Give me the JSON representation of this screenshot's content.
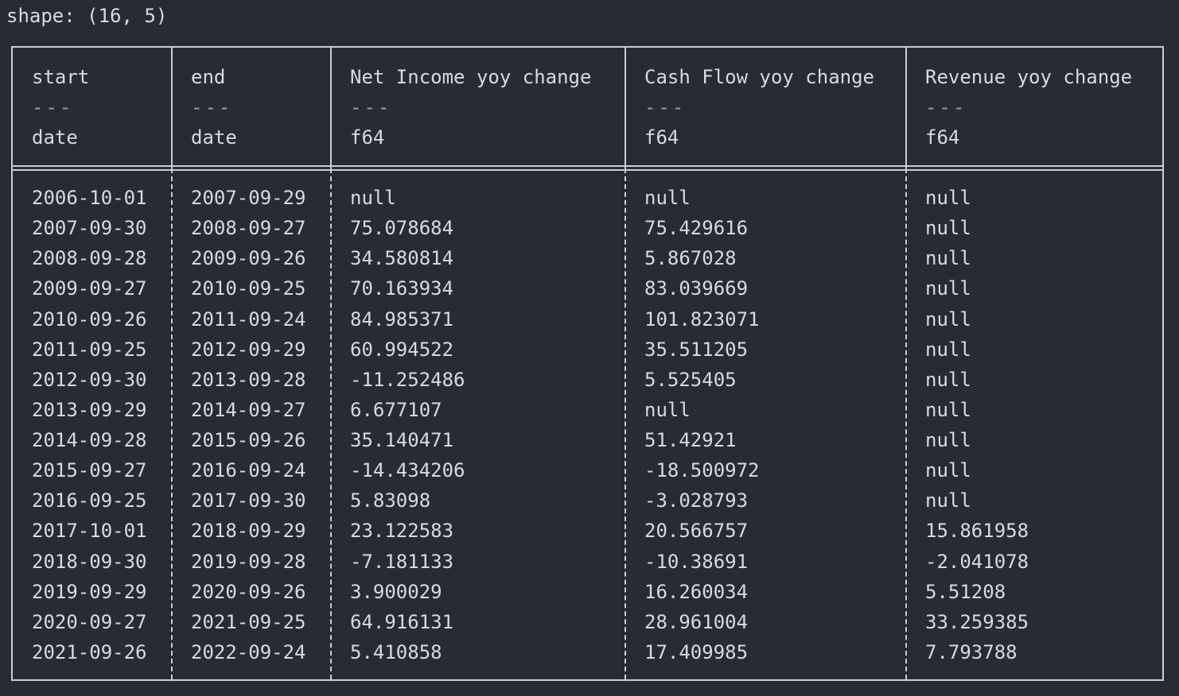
{
  "shape_text": "shape: (16, 5)",
  "table": {
    "columns": [
      {
        "name": "start",
        "separator": "---",
        "dtype": "date"
      },
      {
        "name": "end",
        "separator": "---",
        "dtype": "date"
      },
      {
        "name": "Net Income yoy change",
        "separator": "---",
        "dtype": "f64"
      },
      {
        "name": "Cash Flow yoy change",
        "separator": "---",
        "dtype": "f64"
      },
      {
        "name": "Revenue yoy change",
        "separator": "---",
        "dtype": "f64"
      }
    ],
    "rows": [
      [
        "2006-10-01",
        "2007-09-29",
        "null",
        "null",
        "null"
      ],
      [
        "2007-09-30",
        "2008-09-27",
        "75.078684",
        "75.429616",
        "null"
      ],
      [
        "2008-09-28",
        "2009-09-26",
        "34.580814",
        "5.867028",
        "null"
      ],
      [
        "2009-09-27",
        "2010-09-25",
        "70.163934",
        "83.039669",
        "null"
      ],
      [
        "2010-09-26",
        "2011-09-24",
        "84.985371",
        "101.823071",
        "null"
      ],
      [
        "2011-09-25",
        "2012-09-29",
        "60.994522",
        "35.511205",
        "null"
      ],
      [
        "2012-09-30",
        "2013-09-28",
        "-11.252486",
        "5.525405",
        "null"
      ],
      [
        "2013-09-29",
        "2014-09-27",
        "6.677107",
        "null",
        "null"
      ],
      [
        "2014-09-28",
        "2015-09-26",
        "35.140471",
        "51.42921",
        "null"
      ],
      [
        "2015-09-27",
        "2016-09-24",
        "-14.434206",
        "-18.500972",
        "null"
      ],
      [
        "2016-09-25",
        "2017-09-30",
        "5.83098",
        "-3.028793",
        "null"
      ],
      [
        "2017-10-01",
        "2018-09-29",
        "23.122583",
        "20.566757",
        "15.861958"
      ],
      [
        "2018-09-30",
        "2019-09-28",
        "-7.181133",
        "-10.38691",
        "-2.041078"
      ],
      [
        "2019-09-29",
        "2020-09-26",
        "3.900029",
        "16.260034",
        "5.51208"
      ],
      [
        "2020-09-27",
        "2021-09-25",
        "64.916131",
        "28.961004",
        "33.259385"
      ],
      [
        "2021-09-26",
        "2022-09-24",
        "5.410858",
        "17.409985",
        "7.793788"
      ]
    ]
  }
}
